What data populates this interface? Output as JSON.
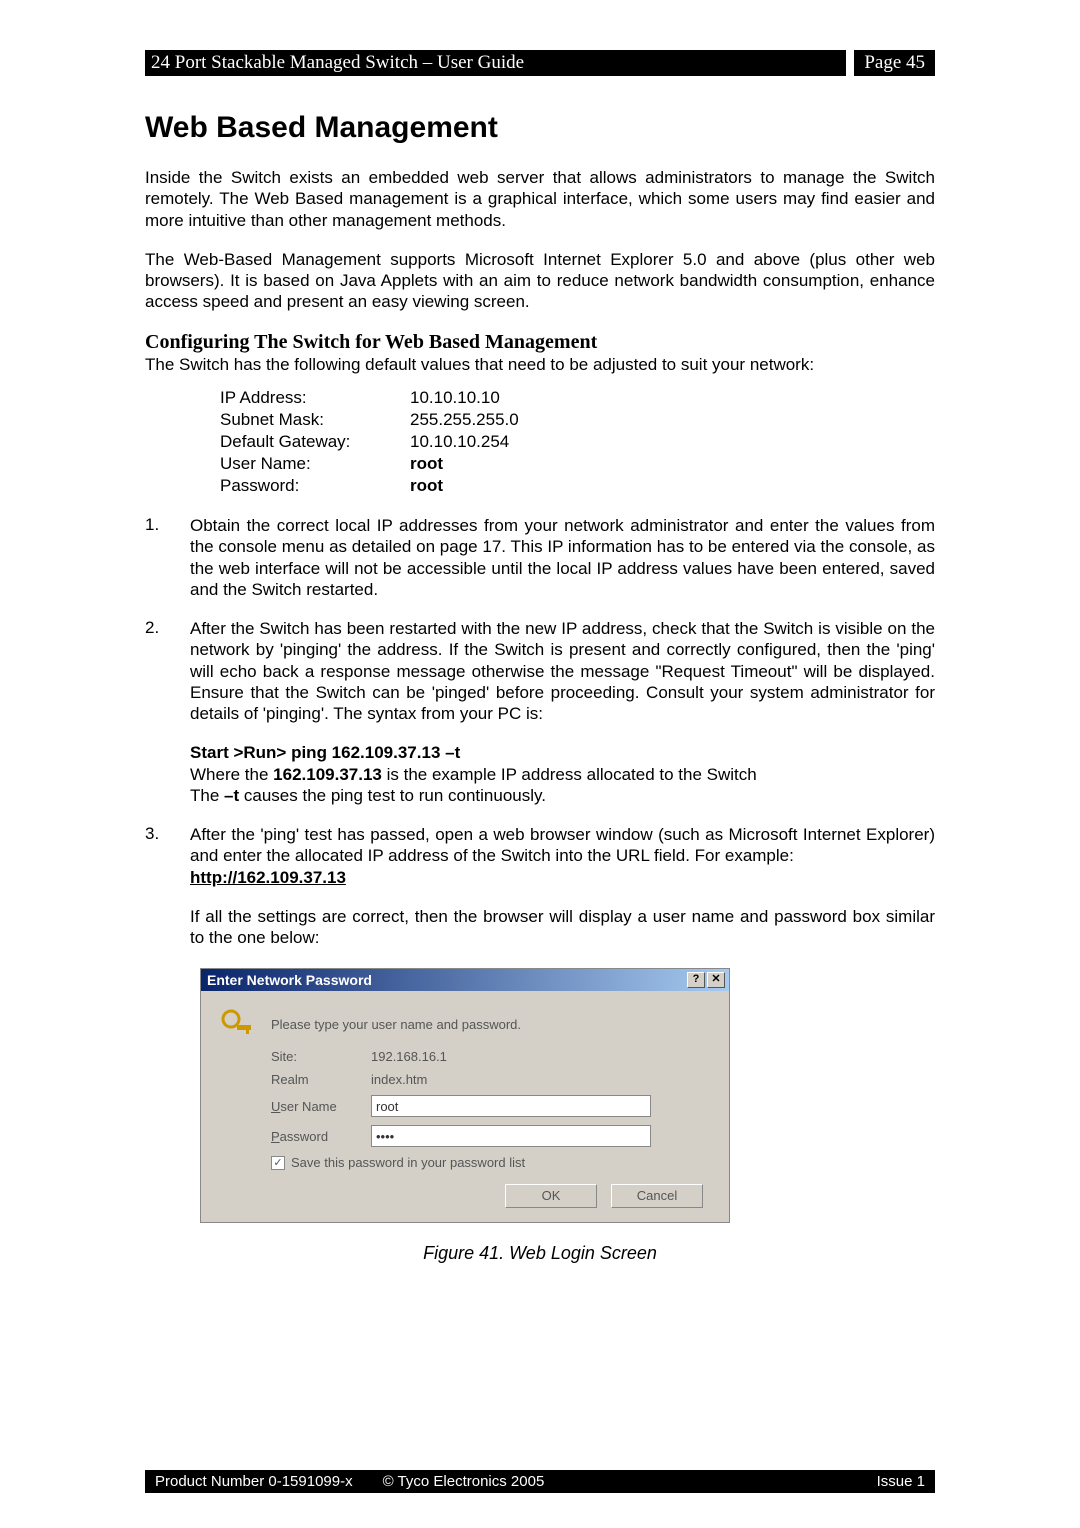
{
  "header": {
    "title": "24 Port Stackable Managed Switch – User Guide",
    "page": "Page 45"
  },
  "h1": "Web Based Management",
  "para1": "Inside the Switch exists an embedded web server that allows administrators to manage the Switch remotely.  The Web Based management is a graphical interface, which some users may find easier and more intuitive than other management methods.",
  "para2": "The Web-Based Management supports Microsoft Internet Explorer 5.0 and above (plus other web browsers). It is based on Java Applets with an aim to reduce network bandwidth consumption, enhance access speed and present an easy viewing screen.",
  "h2": "Configuring The Switch for Web Based Management",
  "subpara": "The Switch has the following default values that need to be adjusted to suit your network:",
  "config": [
    {
      "label": "IP Address:",
      "value": "10.10.10.10",
      "bold": false
    },
    {
      "label": "Subnet Mask:",
      "value": "255.255.255.0",
      "bold": false
    },
    {
      "label": "Default Gateway:",
      "value": "10.10.10.254",
      "bold": false
    },
    {
      "label": "User Name:",
      "value": "root",
      "bold": true
    },
    {
      "label": "Password:",
      "value": "root",
      "bold": true
    }
  ],
  "item1": {
    "num": "1.",
    "text": "Obtain the correct local IP addresses from your network administrator and enter the values from the console menu as detailed on page 17. This IP information has to be entered via the console, as the web interface will not be accessible until the local IP address values have been entered, saved and the Switch restarted."
  },
  "item2": {
    "num": "2.",
    "text": "After the Switch has been restarted with the new IP address, check that the Switch is visible on the network by 'pinging' the address. If the Switch is present and correctly configured, then the 'ping' will echo back a response message otherwise the message \"Request Timeout\" will be displayed. Ensure that the Switch can be 'pinged' before proceeding. Consult your system administrator for details of 'pinging'. The syntax from your PC is:"
  },
  "ping": {
    "cmd": "Start >Run> ping 162.109.37.13 –t",
    "where_pre": "Where the ",
    "where_ip": "162.109.37.13",
    "where_post": " is the example IP address allocated to the Switch",
    "the_pre": "The ",
    "the_flag": "–t",
    "the_post": " causes the ping test to run continuously."
  },
  "item3": {
    "num": "3.",
    "text": "After the 'ping' test has passed, open a web browser window (such as Microsoft Internet Explorer) and enter the allocated IP address of the Switch into the URL field. For example:",
    "link": "http://162.109.37.13"
  },
  "item3b": "If all the settings are correct, then the browser will display a user name and password box similar to the one below:",
  "dialog": {
    "title": "Enter Network Password",
    "prompt": "Please type your user name and password.",
    "site_label": "Site:",
    "site_value": "192.168.16.1",
    "realm_label": "Realm",
    "realm_value": "index.htm",
    "user_label_pre": "U",
    "user_label_post": "ser Name",
    "user_value": "root",
    "pass_label_pre": "P",
    "pass_label_post": "assword",
    "pass_value": "••••",
    "save_label_pre": "S",
    "save_label_post": "ave this password in your password list",
    "ok": "OK",
    "cancel": "Cancel",
    "help": "?",
    "close": "✕"
  },
  "figure_caption": "Figure 41. Web Login Screen",
  "footer": {
    "product": "Product Number 0-1591099-x",
    "copyright": "© Tyco Electronics 2005",
    "issue": "Issue 1"
  }
}
